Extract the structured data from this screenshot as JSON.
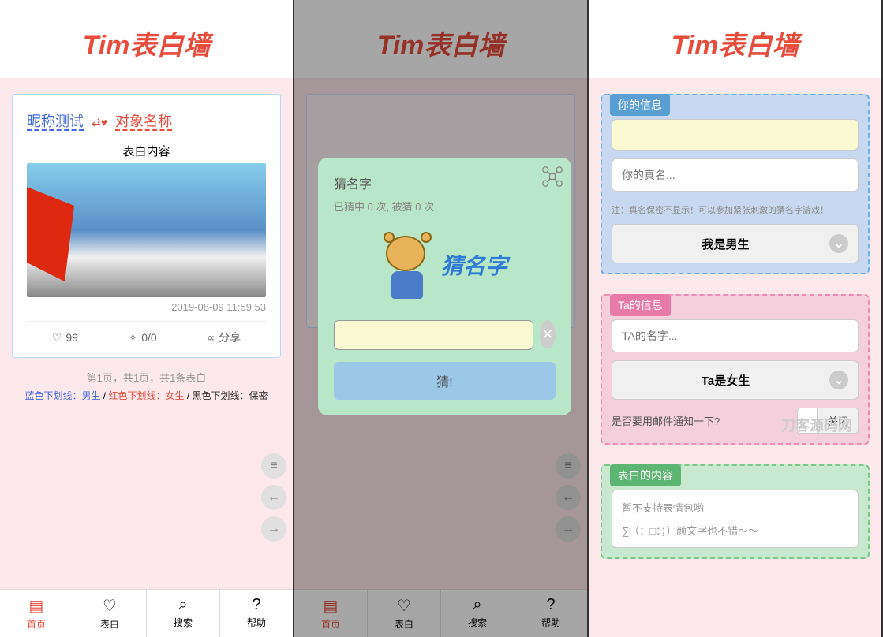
{
  "header": {
    "title": "Tim表白墙"
  },
  "post": {
    "name_from": "昵称测试",
    "name_to": "对象名称",
    "content_label": "表白内容",
    "timestamp": "2019-08-09 11:59:53",
    "likes": "99",
    "comments": "0/0",
    "share": "分享"
  },
  "pagination": "第1页，共1页，共1条表白",
  "legend": {
    "blue": "蓝色下划线：男生",
    "red": "红色下划线：女生",
    "black": "黑色下划线：保密",
    "sep": " / "
  },
  "nav": {
    "home": "首页",
    "confess": "表白",
    "search": "搜索",
    "help": "帮助"
  },
  "popup": {
    "title": "猜名字",
    "stats": "已猜中 0 次, 被猜 0 次.",
    "logo_text": "猜名字",
    "button": "猜!"
  },
  "form": {
    "section1_title": "你的信息",
    "realname_placeholder": "你的真名...",
    "realname_hint": "注：真名保密不显示！可以参加紧张刺激的猜名字游戏！",
    "gender_self": "我是男生",
    "section2_title": "Ta的信息",
    "ta_name_placeholder": "TA的名字...",
    "gender_ta": "Ta是女生",
    "email_question": "是否要用邮件通知一下?",
    "email_off": "关闭",
    "watermark": "刀客源码网",
    "section3_title": "表白的内容",
    "content_placeholder": "暂不支持表情包哟",
    "content_hint": "∑（：□：；）颜文字也不错～～"
  }
}
